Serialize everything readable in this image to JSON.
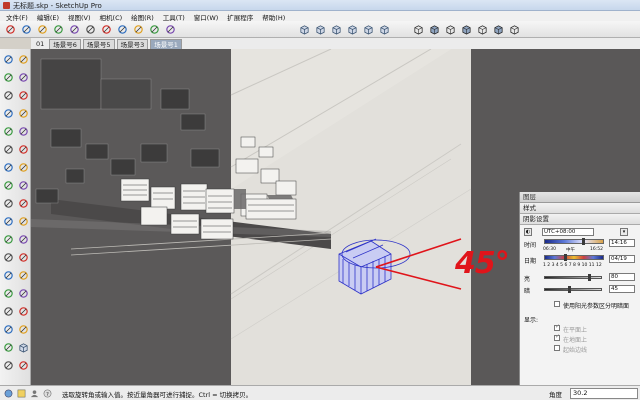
{
  "window": {
    "title": "无标题.skp - SketchUp Pro"
  },
  "menu": [
    "文件(F)",
    "编辑(E)",
    "视图(V)",
    "相机(C)",
    "绘图(R)",
    "工具(T)",
    "窗口(W)",
    "扩展程序",
    "帮助(H)"
  ],
  "toolbar_icons": {
    "group1": [
      "select-icon",
      "orbit-icon",
      "pan-icon",
      "zoom-icon",
      "zoom-window-icon",
      "zoom-extents-icon",
      "rectangle-icon",
      "push-pull-icon",
      "tape-measure-icon",
      "eraser-icon",
      "paint-bucket-icon"
    ],
    "group2": [
      "iso-view-icon",
      "top-view-icon",
      "front-view-icon",
      "right-view-icon",
      "back-view-icon",
      "left-view-icon"
    ],
    "group3": [
      "xray-icon",
      "back-edges-icon",
      "wireframe-icon",
      "hidden-line-icon",
      "shaded-icon",
      "shaded-textures-icon",
      "monochrome-icon"
    ]
  },
  "scenes": {
    "first": "01",
    "tabs": [
      "场景号6",
      "场景号5",
      "场景号3",
      "场景号1"
    ],
    "active_index": 3
  },
  "palette_icons": [
    "select-icon",
    "eraser-icon",
    "paint-bucket-icon",
    "component-icon",
    "line-icon",
    "freehand-icon",
    "rectangle-icon",
    "rotated-rectangle-icon",
    "circle-icon",
    "polygon-icon",
    "arc-icon",
    "pie-icon",
    "push-pull-icon",
    "follow-me-icon",
    "move-icon",
    "rotate-icon",
    "offset-icon",
    "scale-icon",
    "tape-measure-icon",
    "dimension-icon",
    "protractor-icon",
    "text-icon",
    "axes-icon",
    "3d-text-icon",
    "orbit-icon",
    "pan-icon",
    "zoom-icon",
    "zoom-window-icon",
    "walk-icon",
    "look-around-icon",
    "position-camera-icon",
    "section-icon",
    "zoom-extents-icon",
    "previous-view-icon",
    "sandbox-icon",
    "warehouse-icon"
  ],
  "tray": {
    "header": "图层",
    "style_label": "样式",
    "section": "阴影设置",
    "timezone": "UTC+08:00",
    "time_label": "时间",
    "time_value": "14:16",
    "time_scale_left": "06:30",
    "time_scale_mid": "中午",
    "time_scale_right": "16:52",
    "date_label": "日期",
    "date_value": "04/19",
    "months_scale": "1 2 3 4 5 6 7 8 9 10 11 12",
    "light_label": "亮",
    "light_value": "80",
    "dark_label": "暗",
    "dark_value": "45",
    "use_sun_label": "使用阳光参数区分明暗面",
    "display_label": "显示:",
    "on_faces": "在平面上",
    "on_ground": "在地面上",
    "from_edges": "起始边线"
  },
  "annotation": {
    "text": "45°",
    "color": "#e0141a"
  },
  "status": {
    "message": "选取旋转角或输入值。按近量角器可进行捕捉。Ctrl = 切换拷贝。",
    "measure_label": "角度",
    "measure_value": "30.2"
  },
  "colors": {
    "highlight_box": "#2e33c8",
    "annotation": "#e0141a",
    "shadow": "#595757"
  }
}
